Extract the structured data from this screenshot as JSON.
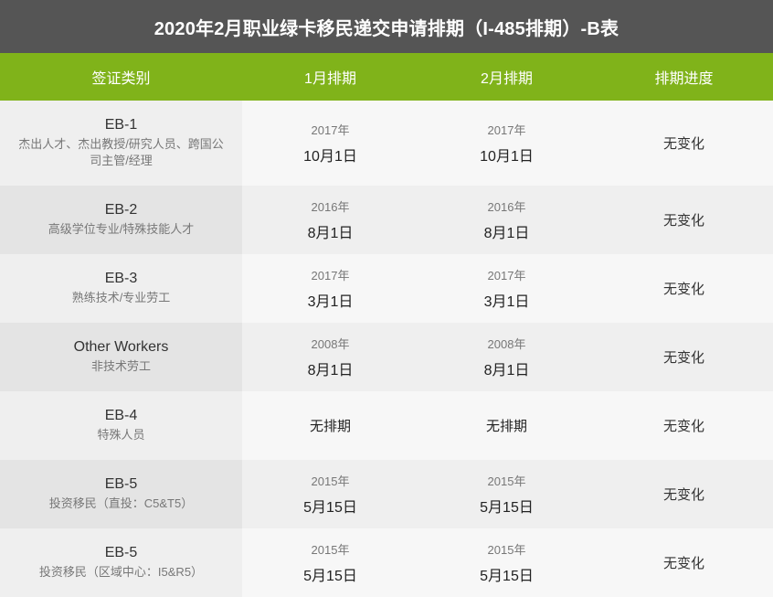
{
  "title": "2020年2月职业绿卡移民递交申请排期（I-485排期）-B表",
  "colors": {
    "title_bg": "#555555",
    "header_bg": "#80b31a"
  },
  "headers": [
    "签证类别",
    "1月排期",
    "2月排期",
    "排期进度"
  ],
  "rows": [
    {
      "code": "EB-1",
      "desc": "杰出人才、杰出教授/研究人员、跨国公司主管/经理",
      "jan": {
        "year": "2017年",
        "day": "10月1日"
      },
      "feb": {
        "year": "2017年",
        "day": "10月1日"
      },
      "progress": "无变化"
    },
    {
      "code": "EB-2",
      "desc": "高级学位专业/特殊技能人才",
      "jan": {
        "year": "2016年",
        "day": "8月1日"
      },
      "feb": {
        "year": "2016年",
        "day": "8月1日"
      },
      "progress": "无变化"
    },
    {
      "code": "EB-3",
      "desc": "熟练技术/专业劳工",
      "jan": {
        "year": "2017年",
        "day": "3月1日"
      },
      "feb": {
        "year": "2017年",
        "day": "3月1日"
      },
      "progress": "无变化"
    },
    {
      "code": "Other Workers",
      "desc": "非技术劳工",
      "jan": {
        "year": "2008年",
        "day": "8月1日"
      },
      "feb": {
        "year": "2008年",
        "day": "8月1日"
      },
      "progress": "无变化"
    },
    {
      "code": "EB-4",
      "desc": "特殊人员",
      "jan": {
        "single": "无排期"
      },
      "feb": {
        "single": "无排期"
      },
      "progress": "无变化"
    },
    {
      "code": "EB-5",
      "desc": "投资移民（直投：C5&T5）",
      "jan": {
        "year": "2015年",
        "day": "5月15日"
      },
      "feb": {
        "year": "2015年",
        "day": "5月15日"
      },
      "progress": "无变化"
    },
    {
      "code": "EB-5",
      "desc": "投资移民（区域中心：I5&R5）",
      "jan": {
        "year": "2015年",
        "day": "5月15日"
      },
      "feb": {
        "year": "2015年",
        "day": "5月15日"
      },
      "progress": "无变化"
    }
  ]
}
